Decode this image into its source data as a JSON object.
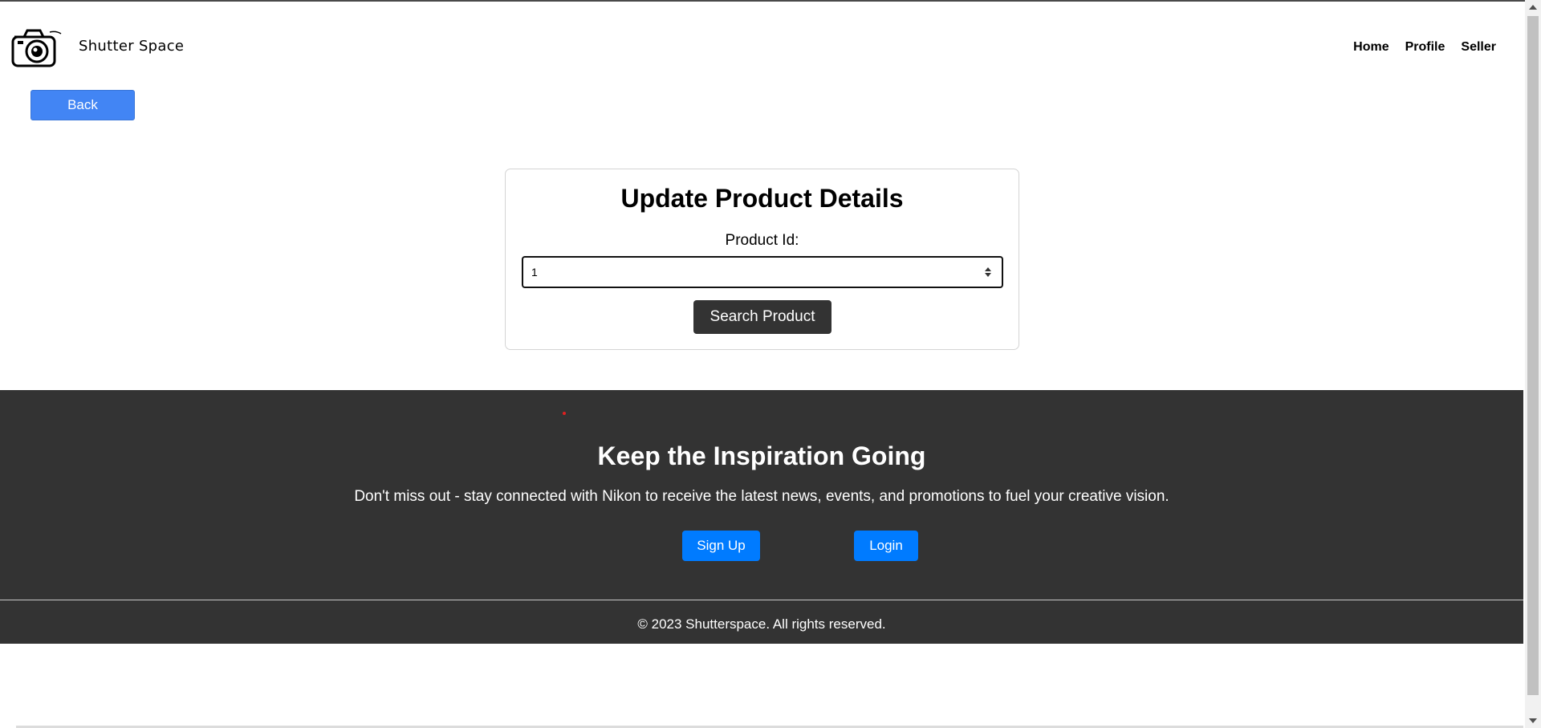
{
  "header": {
    "brand": "Shutter Space",
    "nav": [
      {
        "label": "Home"
      },
      {
        "label": "Profile"
      },
      {
        "label": "Seller"
      }
    ]
  },
  "back_button": "Back",
  "form": {
    "title": "Update Product Details",
    "product_id_label": "Product Id:",
    "product_id_value": "1",
    "search_button": "Search Product"
  },
  "promo": {
    "title": "Keep the Inspiration Going",
    "text": "Don't miss out - stay connected with Nikon to receive the latest news, events, and promotions to fuel your creative vision.",
    "signup_button": "Sign Up",
    "login_button": "Login"
  },
  "footer": {
    "copyright": "© 2023 Shutterspace. All rights reserved."
  },
  "colors": {
    "primary_blue": "#4285f4",
    "button_blue": "#007bff",
    "dark_band": "#333333"
  },
  "icons": {
    "logo": "camera-logo-icon",
    "spinner": "number-spinner-icon"
  }
}
